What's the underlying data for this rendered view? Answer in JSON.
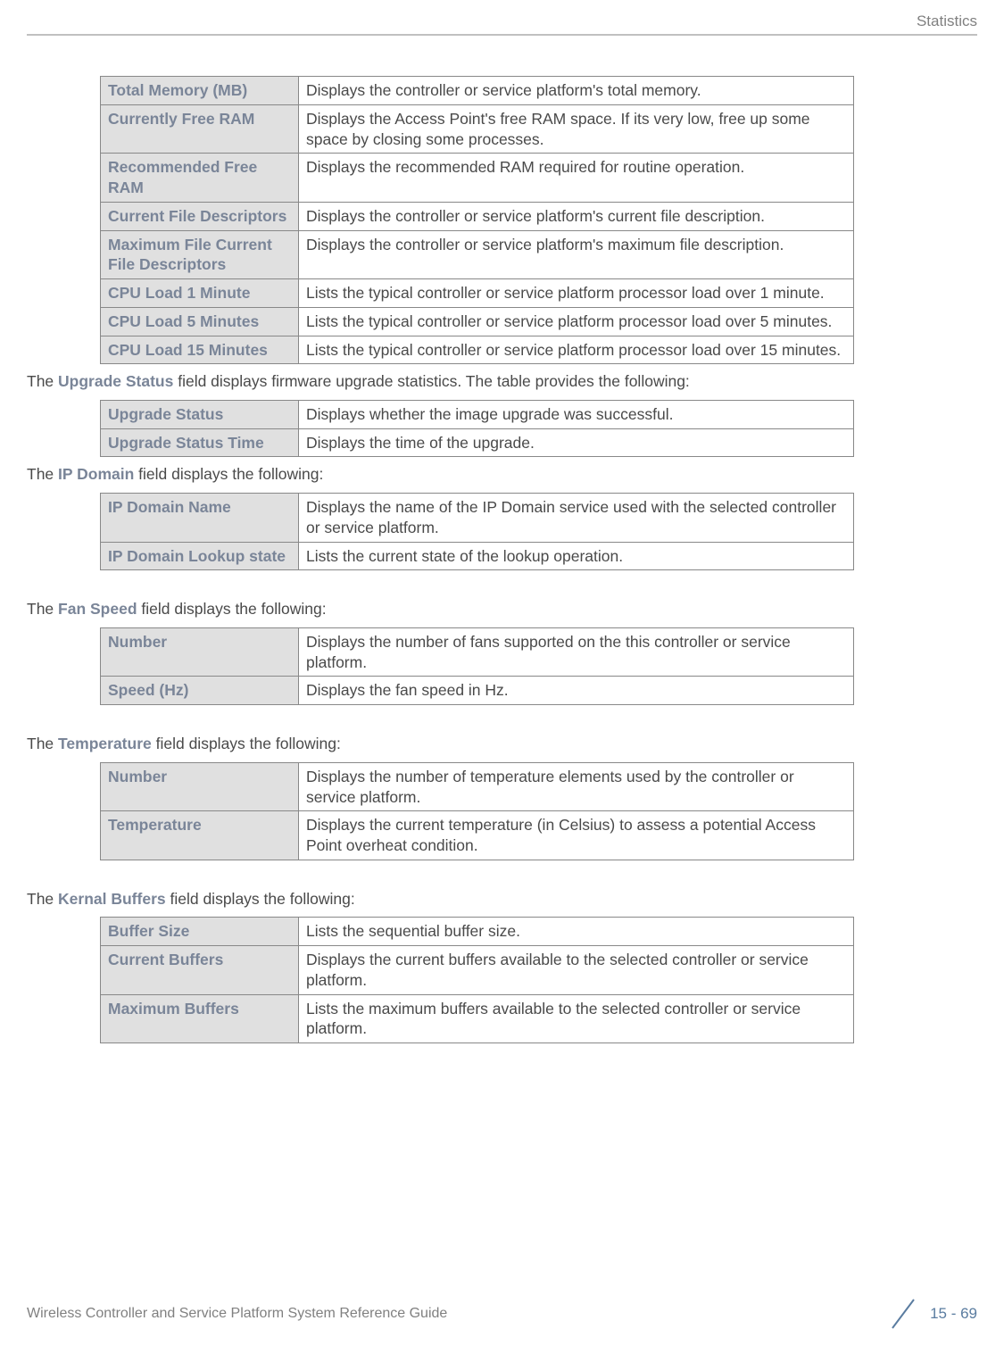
{
  "header": {
    "section": "Statistics"
  },
  "table1": {
    "rows": [
      {
        "label": "Total Memory (MB)",
        "desc": "Displays the controller or service platform's total memory."
      },
      {
        "label": "Currently Free RAM",
        "desc": "Displays the Access Point's free RAM space. If its very low, free up some space by closing some processes."
      },
      {
        "label": "Recommended Free RAM",
        "desc": "Displays the recommended RAM required for routine operation."
      },
      {
        "label": "Current File Descriptors",
        "desc": "Displays the controller or service platform's current file description."
      },
      {
        "label": "Maximum File Current File Descriptors",
        "desc": "Displays the controller or service platform's maximum file description."
      },
      {
        "label": "CPU Load 1 Minute",
        "desc": "Lists the typical controller or service platform processor load over 1 minute."
      },
      {
        "label": "CPU Load 5 Minutes",
        "desc": "Lists the typical controller or service platform processor load over 5 minutes."
      },
      {
        "label": "CPU Load 15 Minutes",
        "desc": "Lists the typical controller or service platform processor load over 15 minutes."
      }
    ]
  },
  "section2": {
    "prefix": "The ",
    "bold": "Upgrade Status",
    "suffix": " field displays firmware upgrade statistics. The table provides the following:"
  },
  "table2": {
    "rows": [
      {
        "label": "Upgrade Status",
        "desc": "Displays whether the image upgrade was successful."
      },
      {
        "label": "Upgrade Status Time",
        "desc": "Displays the time of the upgrade."
      }
    ]
  },
  "section3": {
    "prefix": "The ",
    "bold": "IP Domain",
    "suffix": " field displays the following:"
  },
  "table3": {
    "rows": [
      {
        "label": "IP Domain Name",
        "desc": "Displays the name of the IP Domain service used with the selected controller or service platform."
      },
      {
        "label": "IP Domain Lookup state",
        "desc": "Lists the current state of the lookup operation."
      }
    ]
  },
  "section4": {
    "prefix": "The ",
    "bold": "Fan Speed",
    "suffix": " field displays the following:"
  },
  "table4": {
    "rows": [
      {
        "label": "Number",
        "desc": "Displays the number of fans supported on the this controller or service platform."
      },
      {
        "label": "Speed (Hz)",
        "desc": "Displays the fan speed in Hz."
      }
    ]
  },
  "section5": {
    "prefix": "The ",
    "bold": "Temperature",
    "suffix": " field displays the following:"
  },
  "table5": {
    "rows": [
      {
        "label": "Number",
        "desc": "Displays the number of temperature elements used by the controller or service platform."
      },
      {
        "label": "Temperature",
        "desc": "Displays the current temperature (in Celsius) to assess a potential Access Point overheat condition."
      }
    ]
  },
  "section6": {
    "prefix": "The ",
    "bold": "Kernal Buffers",
    "suffix": " field displays the following:"
  },
  "table6": {
    "rows": [
      {
        "label": "Buffer Size",
        "desc": "Lists the sequential buffer size."
      },
      {
        "label": "Current Buffers",
        "desc": "Displays the current buffers available to the selected controller or service platform."
      },
      {
        "label": "Maximum Buffers",
        "desc": "Lists the maximum buffers available to the selected controller or service platform."
      }
    ]
  },
  "footer": {
    "guide": "Wireless Controller and Service Platform System Reference Guide",
    "page": "15 - 69"
  }
}
